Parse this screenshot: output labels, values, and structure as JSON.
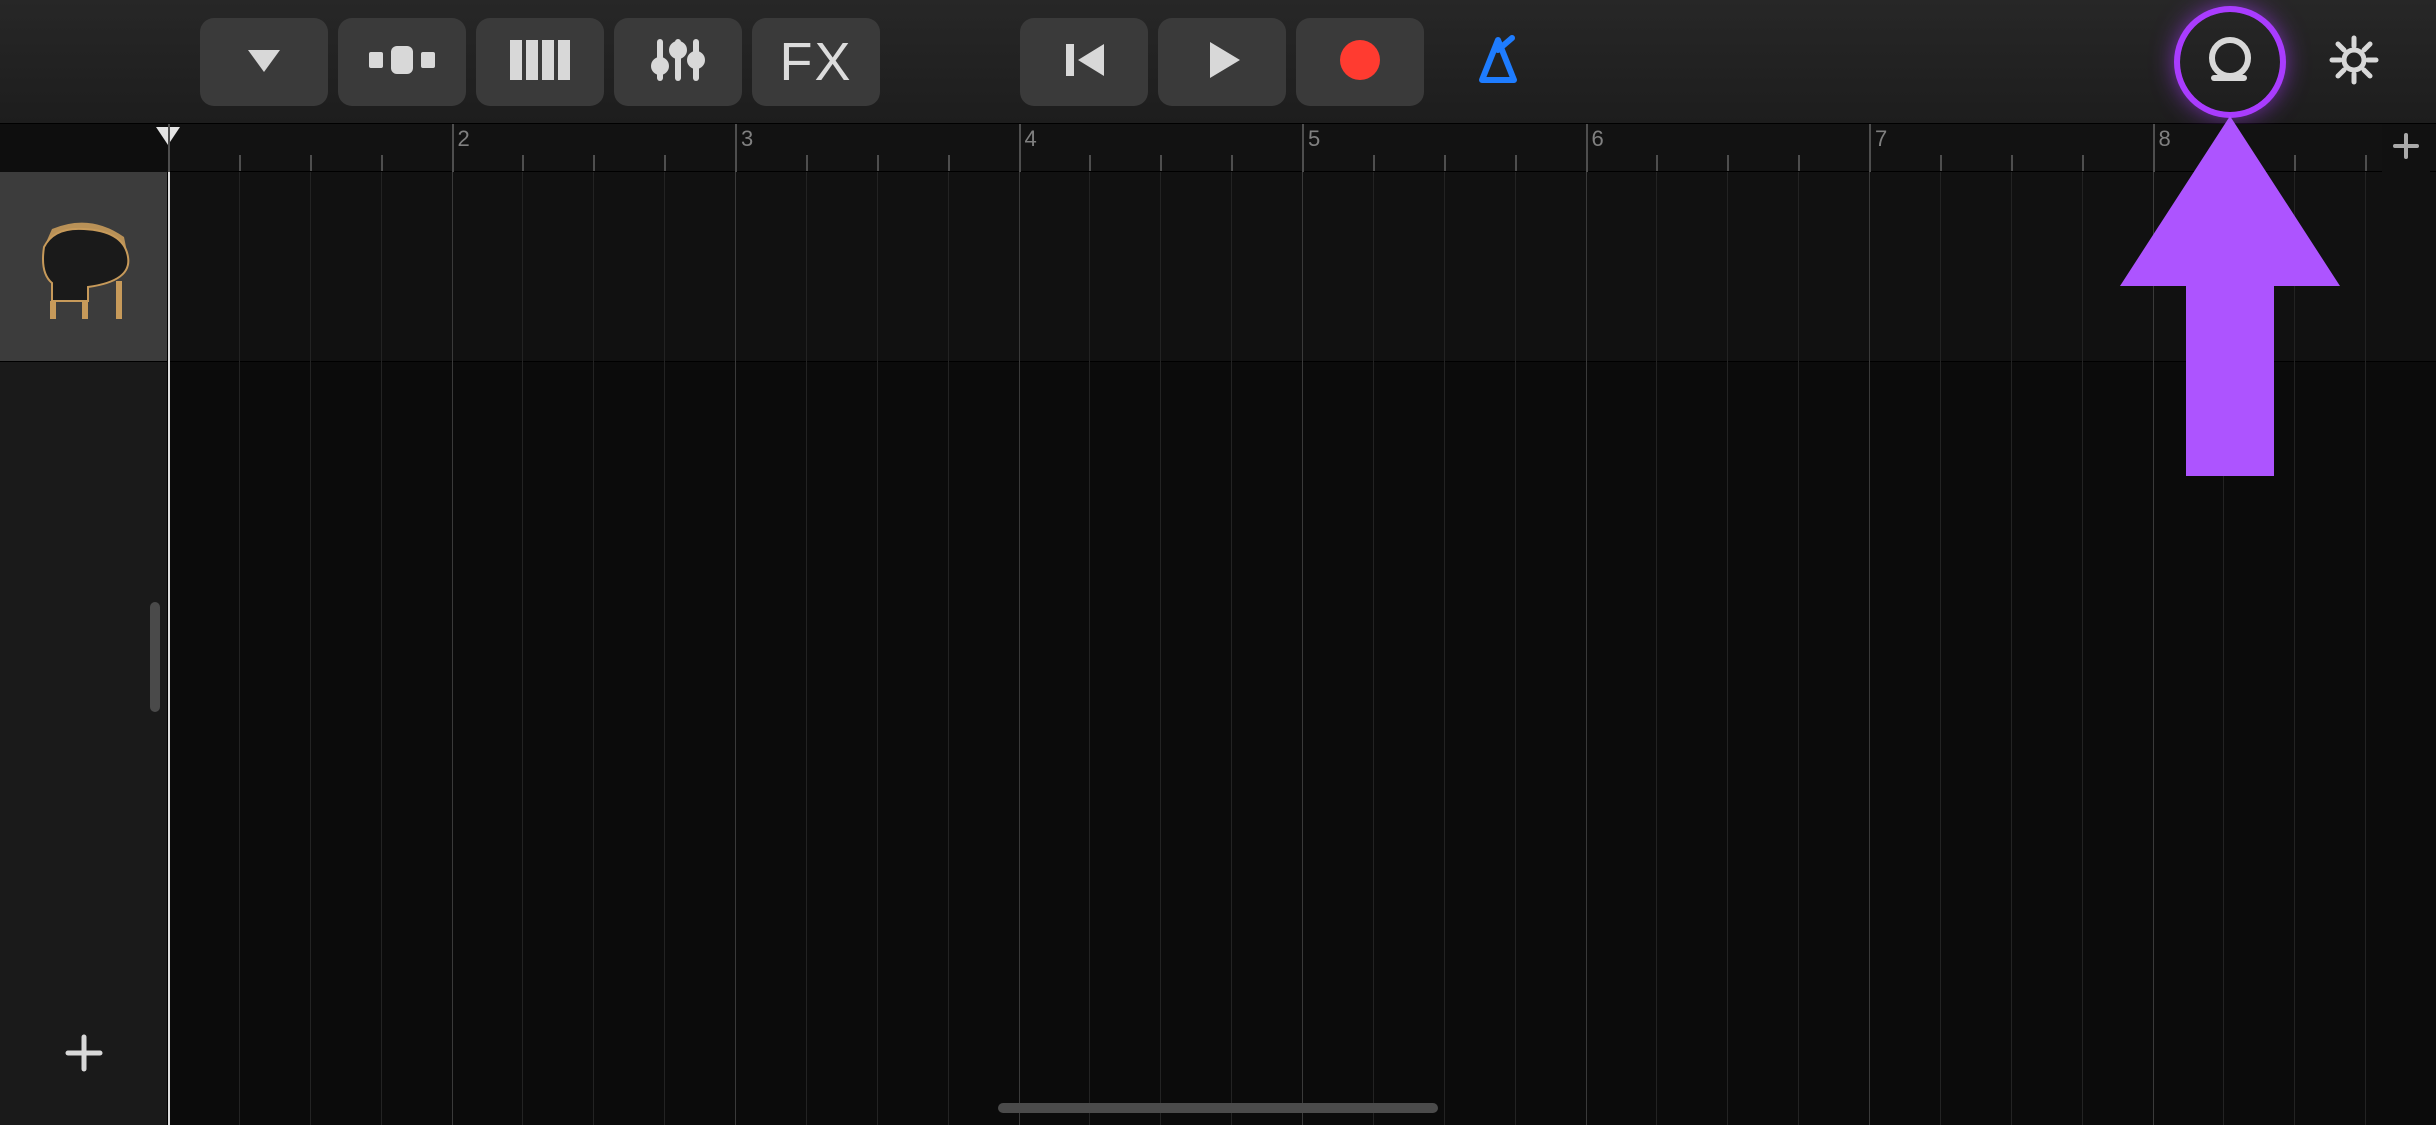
{
  "toolbar": {
    "view_menu_icon": "chevron-down-icon",
    "track_view_icon": "track-view-icon",
    "keyboard_view_icon": "piano-keys-icon",
    "mixer_icon": "mixer-faders-icon",
    "fx_label": "FX",
    "rewind_icon": "rewind-icon",
    "play_icon": "play-icon",
    "record_icon": "record-icon",
    "metronome_icon": "metronome-icon",
    "loop_icon": "loop-icon",
    "settings_icon": "settings-gear-icon"
  },
  "ruler": {
    "bars": [
      "2",
      "3",
      "4",
      "5",
      "6",
      "7",
      "8"
    ],
    "subdivisions_per_bar": 4,
    "playhead_bar_index": 0
  },
  "tracks": {
    "items": [
      {
        "name": "Grand Piano",
        "icon": "grand-piano-icon"
      }
    ]
  },
  "colors": {
    "accent_blue": "#1e7cff",
    "highlight_purple": "#a93cff",
    "record_red": "#ff3b30"
  }
}
